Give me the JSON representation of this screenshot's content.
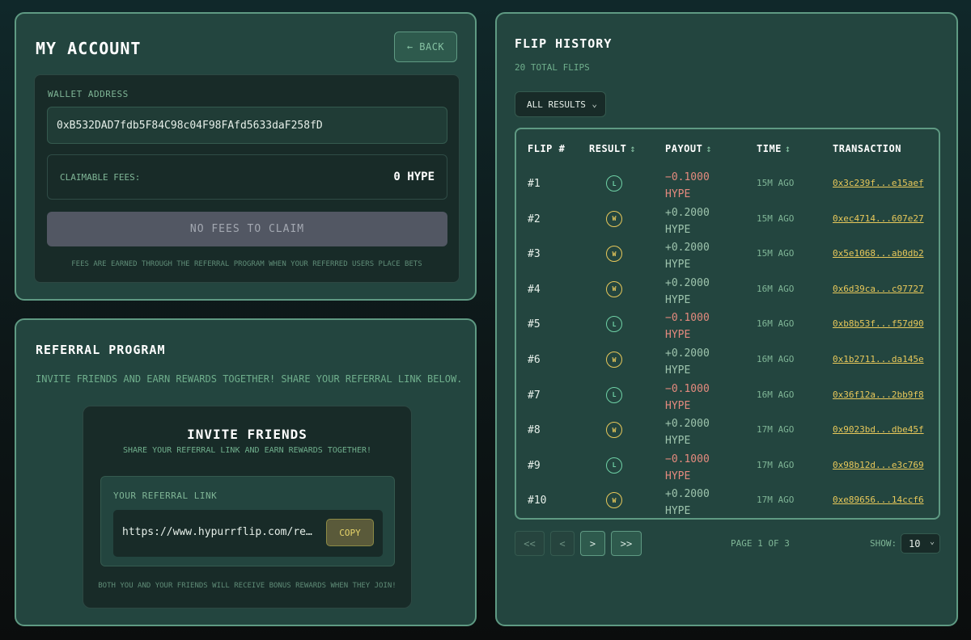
{
  "account": {
    "title": "MY ACCOUNT",
    "back_label": "← BACK",
    "wallet_label": "WALLET ADDRESS",
    "wallet_address": "0xB532DAD7fdb5F84C98c04F98FAfd5633daF258fD",
    "fees_label": "CLAIMABLE FEES:",
    "fees_value": "0 HYPE",
    "claim_button": "NO FEES TO CLAIM",
    "fees_note": "FEES ARE EARNED THROUGH THE REFERRAL PROGRAM WHEN YOUR REFERRED USERS PLACE BETS"
  },
  "referral": {
    "title": "REFERRAL PROGRAM",
    "description": "INVITE FRIENDS AND EARN REWARDS TOGETHER! SHARE YOUR REFERRAL LINK BELOW.",
    "card_title": "INVITE FRIENDS",
    "card_subtitle": "SHARE YOUR REFERRAL LINK AND EARN REWARDS TOGETHER!",
    "link_label": "YOUR REFERRAL LINK",
    "link_value": "https://www.hypurrflip.com/re…",
    "copy_label": "COPY",
    "note": "BOTH YOU AND YOUR FRIENDS WILL RECEIVE BONUS REWARDS WHEN THEY JOIN!"
  },
  "history": {
    "title": "FLIP HISTORY",
    "total": "20 TOTAL FLIPS",
    "filter_value": "ALL RESULTS",
    "columns": {
      "flip": "FLIP #",
      "result": "RESULT",
      "payout": "PAYOUT",
      "time": "TIME",
      "transaction": "TRANSACTION"
    },
    "sort_icon": "↕",
    "rows": [
      {
        "num": "#1",
        "result": "L",
        "payout": "−0.1000",
        "unit": "HYPE",
        "time": "15M AGO",
        "tx": "0x3c239f...e15aef"
      },
      {
        "num": "#2",
        "result": "W",
        "payout": "+0.2000",
        "unit": "HYPE",
        "time": "15M AGO",
        "tx": "0xec4714...607e27"
      },
      {
        "num": "#3",
        "result": "W",
        "payout": "+0.2000",
        "unit": "HYPE",
        "time": "15M AGO",
        "tx": "0x5e1068...ab0db2"
      },
      {
        "num": "#4",
        "result": "W",
        "payout": "+0.2000",
        "unit": "HYPE",
        "time": "16M AGO",
        "tx": "0x6d39ca...c97727"
      },
      {
        "num": "#5",
        "result": "L",
        "payout": "−0.1000",
        "unit": "HYPE",
        "time": "16M AGO",
        "tx": "0xb8b53f...f57d90"
      },
      {
        "num": "#6",
        "result": "W",
        "payout": "+0.2000",
        "unit": "HYPE",
        "time": "16M AGO",
        "tx": "0x1b2711...da145e"
      },
      {
        "num": "#7",
        "result": "L",
        "payout": "−0.1000",
        "unit": "HYPE",
        "time": "16M AGO",
        "tx": "0x36f12a...2bb9f8"
      },
      {
        "num": "#8",
        "result": "W",
        "payout": "+0.2000",
        "unit": "HYPE",
        "time": "17M AGO",
        "tx": "0x9023bd...dbe45f"
      },
      {
        "num": "#9",
        "result": "L",
        "payout": "−0.1000",
        "unit": "HYPE",
        "time": "17M AGO",
        "tx": "0x98b12d...e3c769"
      },
      {
        "num": "#10",
        "result": "W",
        "payout": "+0.2000",
        "unit": "HYPE",
        "time": "17M AGO",
        "tx": "0xe89656...14ccf6"
      }
    ],
    "pagination": {
      "first": "<<",
      "prev": "<",
      "next": ">",
      "last": ">>",
      "page_info": "PAGE 1 OF 3",
      "show_label": "SHOW:",
      "show_value": "10"
    }
  },
  "colors": {
    "panel_bg": "#23453f",
    "panel_border": "#5f9a83",
    "win": "#e8c85a",
    "loss": "#e48a7e",
    "loss_badge": "#6fd1a6"
  }
}
